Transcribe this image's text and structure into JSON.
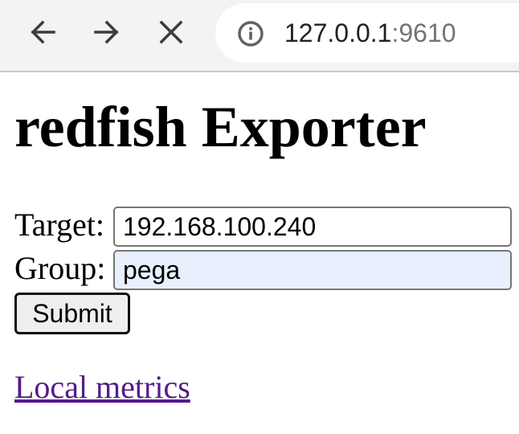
{
  "browser": {
    "back_icon": "arrow-left-icon",
    "forward_icon": "arrow-right-icon",
    "stop_icon": "close-icon",
    "site_info_icon": "info-icon",
    "url_host": "127.0.0.1",
    "url_port": ":9610",
    "colors": {
      "toolbar_bg": "#f1f3f4",
      "url_host": "#202124",
      "url_port": "#70757a",
      "icon": "#5f6368"
    }
  },
  "page": {
    "title": "redfish Exporter",
    "form": {
      "target_label": "Target:",
      "target_value": "192.168.100.240",
      "group_label": "Group:",
      "group_value": "pega",
      "submit_label": "Submit"
    },
    "link": {
      "label": "Local metrics",
      "color": "#551a8b"
    }
  }
}
